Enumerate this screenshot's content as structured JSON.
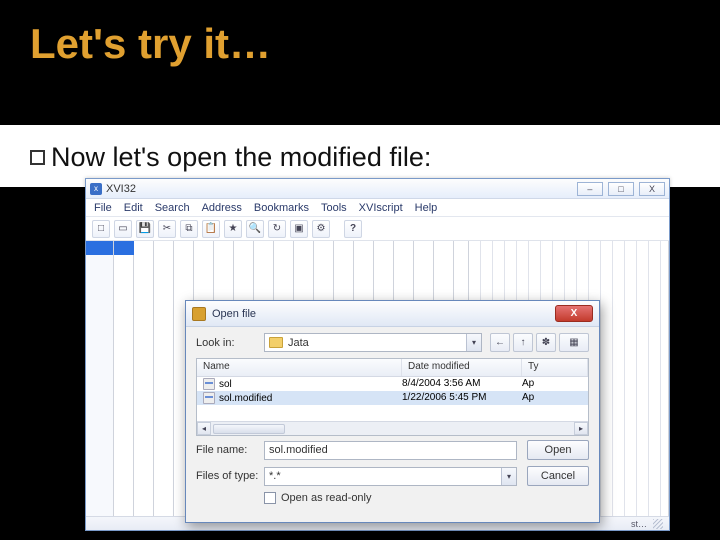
{
  "slide": {
    "title": "Let's try it…",
    "bullet": "Now let's open the modified file:"
  },
  "app": {
    "title": "XVI32",
    "menus": [
      "File",
      "Edit",
      "Search",
      "Address",
      "Bookmarks",
      "Tools",
      "XVIscript",
      "Help"
    ],
    "winbtns": {
      "min": "–",
      "max": "□",
      "close": "X"
    },
    "status_right": "st…"
  },
  "dialog": {
    "title": "Open file",
    "close": "X",
    "lookin_label": "Look in:",
    "lookin_value": "Jata",
    "nav": {
      "back": "←",
      "up": "↑",
      "newfolder": "✽",
      "views": "▦"
    },
    "headers": {
      "name": "Name",
      "date": "Date modified",
      "type": "Ty"
    },
    "files": [
      {
        "name": "sol",
        "date": "8/4/2004 3:56 AM",
        "type": "Ap"
      },
      {
        "name": "sol.modified",
        "date": "1/22/2006 5:45 PM",
        "type": "Ap"
      }
    ],
    "filename_label": "File name:",
    "filename_value": "sol.modified",
    "filetype_label": "Files of type:",
    "filetype_value": "*.*",
    "readonly_label": "Open as read-only",
    "open": "Open",
    "cancel": "Cancel"
  }
}
